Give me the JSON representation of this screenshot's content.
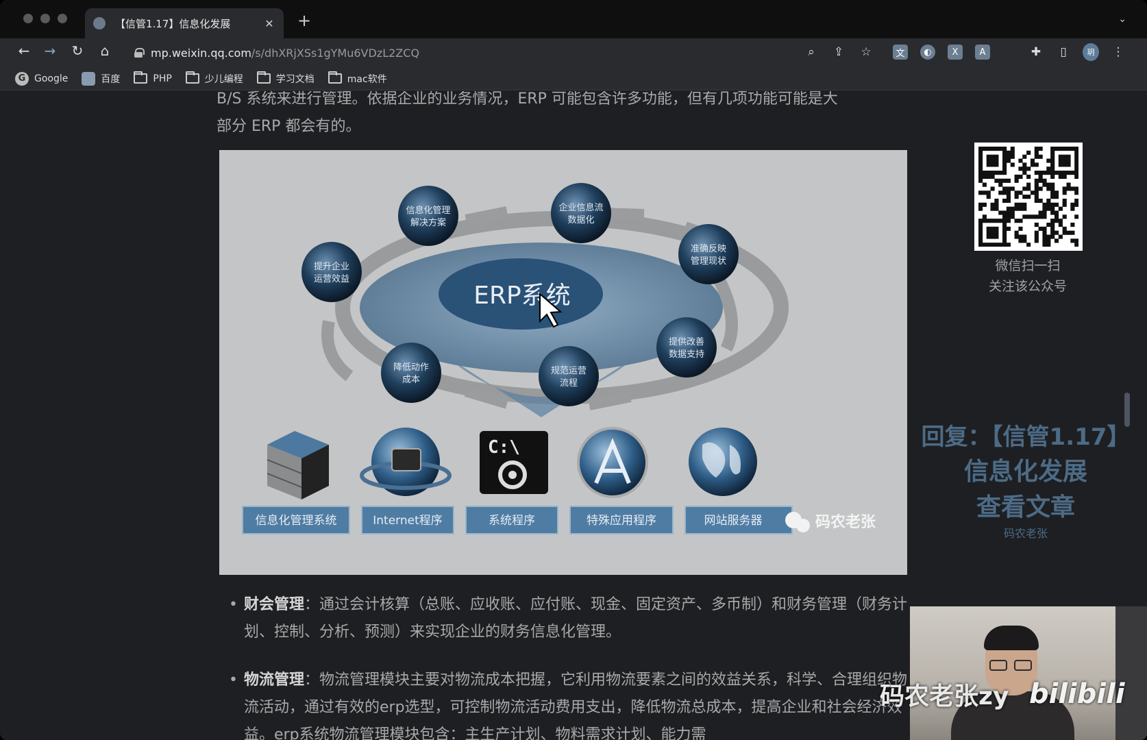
{
  "browser": {
    "tab_title": "【信管1.17】信息化发展",
    "url_host": "mp.weixin.qq.com",
    "url_path": "/s/dhXRjXSs1gYMu6VDzL2ZCQ",
    "profile_initial": "玥",
    "bookmarks": [
      "Google",
      "百度",
      "PHP",
      "少儿编程",
      "学习文档",
      "mac软件"
    ]
  },
  "article": {
    "intro_line1": "B/S 系统来进行管理。依据企业的业务情况，ERP 可能包含许多功能，但有几项功能可能是大",
    "intro_line2": "部分 ERP 都会有的。",
    "figure": {
      "center_label": "ERP系统",
      "nodes": [
        [
          "信息化管理",
          "解决方案"
        ],
        [
          "企业信息流",
          "数据化"
        ],
        [
          "准确反映",
          "管理现状"
        ],
        [
          "提供改善",
          "数据支持"
        ],
        [
          "规范运营",
          "流程"
        ],
        [
          "降低动作",
          "成本"
        ],
        [
          "提升企业",
          "运营效益"
        ]
      ],
      "icon_labels": [
        "信息化管理系统",
        "Internet程序",
        "系统程序",
        "特殊应用程序",
        "网站服务器"
      ],
      "cmd_text": "C:\\",
      "watermark": "码农老张"
    },
    "bullets": [
      {
        "title": "财会管理",
        "text": "：通过会计核算（总账、应收账、应付账、现金、固定资产、多币制）和财务管理（财务计划、控制、分析、预测）来实现企业的财务信息化管理。"
      },
      {
        "title": "物流管理",
        "text": "：物流管理模块主要对物流成本把握，它利用物流要素之间的效益关系，科学、合理组织物流活动，通过有效的erp选型，可控制物流活动费用支出，降低物流总成本，提高企业和社会经济效益。erp系统物流管理模块包含：主生产计划、物料需求计划、能力需"
      }
    ]
  },
  "sidebar": {
    "qr_caption_1": "微信扫一扫",
    "qr_caption_2": "关注该公众号",
    "reply_line1": "回复：【信管1.17】",
    "reply_line2": "信息化发展",
    "reply_line3": "查看文章",
    "reply_author": "码农老张"
  },
  "overlay": {
    "watermark": "码农老张zy",
    "brand": "bilibili"
  },
  "colors": {
    "page_bg": "#1e1f22",
    "body_text": "#a9a9a9",
    "reply_accent": "#4c6b86"
  }
}
